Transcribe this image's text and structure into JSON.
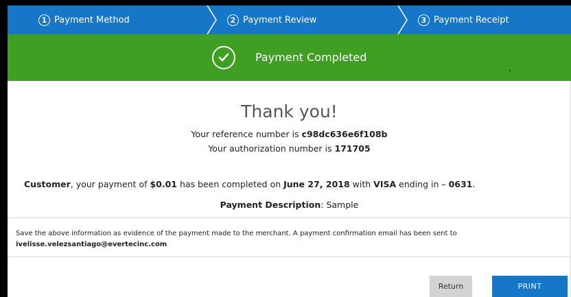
{
  "steps": [
    {
      "number": "1",
      "label": "Payment Method"
    },
    {
      "number": "2",
      "label": "Payment Review"
    },
    {
      "number": "3",
      "label": "Payment Receipt"
    }
  ],
  "banner": {
    "text": "Payment Completed"
  },
  "receipt": {
    "thank_you": "Thank you!",
    "reference_prefix": "Your reference number is ",
    "reference_number": "c98dc636e6f108b",
    "authorization_prefix": "Your authorization number is ",
    "authorization_number": "171705",
    "customer_label": "Customer",
    "payment_text_1": ", your payment of ",
    "amount": "$0.01",
    "payment_text_2": " has been completed on ",
    "date": "June 27, 2018",
    "payment_text_3": " with ",
    "card_brand": "VISA",
    "payment_text_4": " ending in – ",
    "card_last4": "0631",
    "payment_text_5": ".",
    "description_label": "Payment Description",
    "description_sep": ": ",
    "description_value": "Sample"
  },
  "notice": {
    "text": "Save the above information as evidence of the payment made to the merchant. A payment confirmation email has been sent to",
    "email": "ivelisse.velezsantiago@evertecinc.com"
  },
  "buttons": {
    "return_label": "Return",
    "print_label": "PRINT"
  },
  "colors": {
    "primary": "#1677c9",
    "success": "#3f9f23"
  }
}
